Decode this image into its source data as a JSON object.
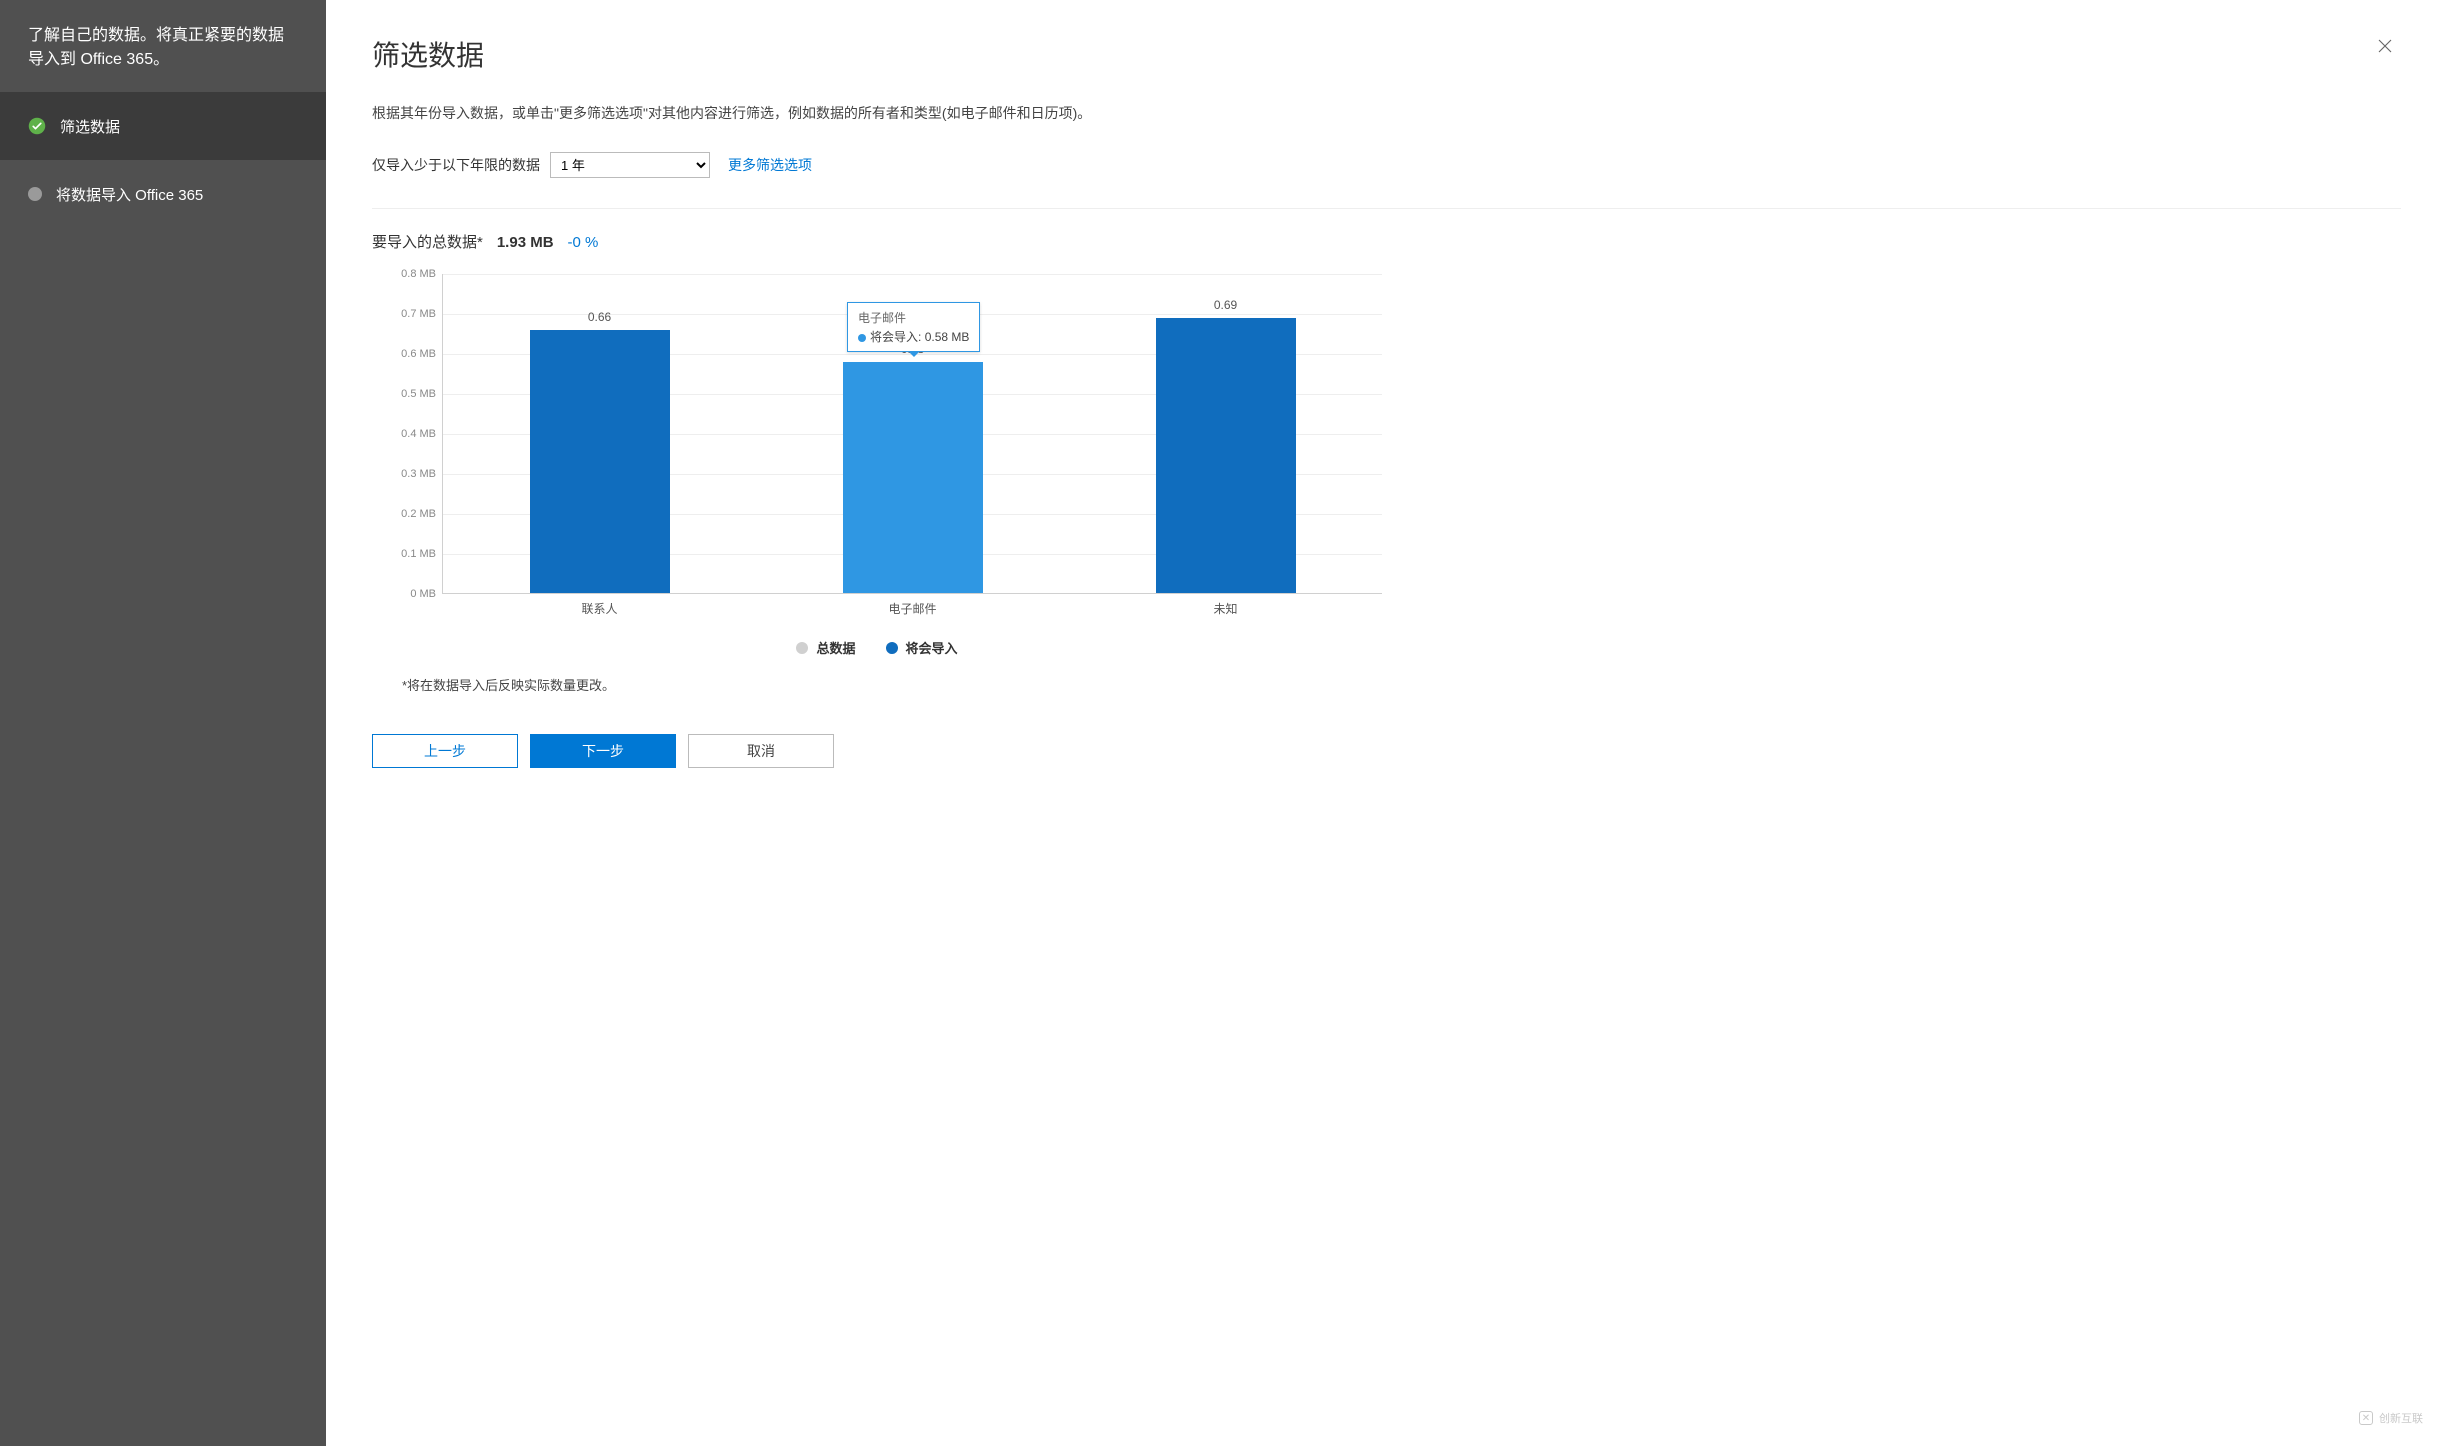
{
  "sidebar": {
    "header": "了解自己的数据。将真正紧要的数据导入到 Office 365。",
    "steps": [
      {
        "label": "筛选数据"
      },
      {
        "label": "将数据导入 Office 365"
      }
    ]
  },
  "main": {
    "title": "筛选数据",
    "description": "根据其年份导入数据，或单击\"更多筛选选项\"对其他内容进行筛选，例如数据的所有者和类型(如电子邮件和日历项)。",
    "filter_label": "仅导入少于以下年限的数据",
    "age_select_value": "1 年",
    "more_filters": "更多筛选选项",
    "total_label": "要导入的总数据*",
    "total_value": "1.93 MB",
    "total_delta": "-0 %",
    "footnote": "*将在数据导入后反映实际数量更改。",
    "buttons": {
      "back": "上一步",
      "next": "下一步",
      "cancel": "取消"
    },
    "watermark": "创新互联"
  },
  "legend": {
    "total": "总数据",
    "will_import": "将会导入"
  },
  "tooltip": {
    "category": "电子邮件",
    "series": "将会导入",
    "value": "0.58 MB"
  },
  "chart_data": {
    "type": "bar",
    "categories": [
      "联系人",
      "电子邮件",
      "未知"
    ],
    "series": [
      {
        "name": "将会导入",
        "values": [
          0.66,
          0.58,
          0.69
        ]
      }
    ],
    "bar_labels": [
      "0.66",
      "0.58",
      "0.69"
    ],
    "y_ticks": [
      "0 MB",
      "0.1 MB",
      "0.2 MB",
      "0.3 MB",
      "0.4 MB",
      "0.5 MB",
      "0.6 MB",
      "0.7 MB",
      "0.8 MB"
    ],
    "ymax": 0.8,
    "ylabel": "",
    "xlabel": "",
    "title": ""
  }
}
